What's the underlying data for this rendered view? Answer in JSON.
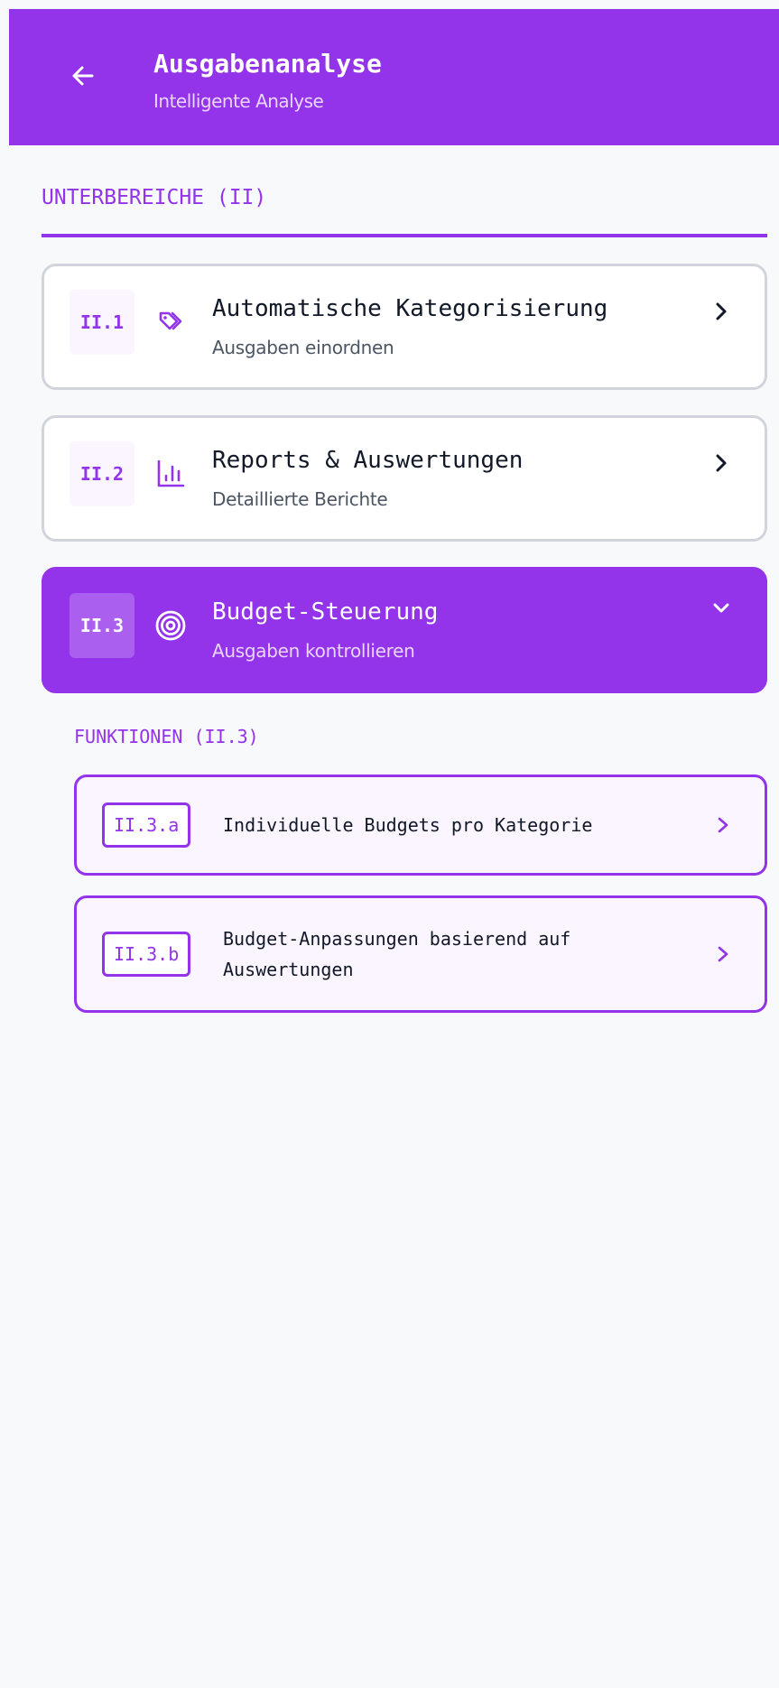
{
  "header": {
    "title": "Ausgabenanalyse",
    "subtitle": "Intelligente Analyse",
    "back_icon": "arrow-left-icon"
  },
  "section": {
    "label": "UNTERBEREICHE (II)"
  },
  "subsections": [
    {
      "code": "II.1",
      "icon": "tags-icon",
      "title": "Automatische Kategorisierung",
      "subtitle": "Ausgaben einordnen",
      "state": "collapsed"
    },
    {
      "code": "II.2",
      "icon": "bar-chart-icon",
      "title": "Reports & Auswertungen",
      "subtitle": "Detaillierte Berichte",
      "state": "collapsed"
    },
    {
      "code": "II.3",
      "icon": "target-icon",
      "title": "Budget-Steuerung",
      "subtitle": "Ausgaben kontrollieren",
      "state": "expanded"
    }
  ],
  "functions": {
    "label": "FUNKTIONEN (II.3)",
    "items": [
      {
        "code": "II.3.a",
        "text": "Individuelle Budgets pro Kategorie"
      },
      {
        "code": "II.3.b",
        "text": "Budget-Anpassungen basierend auf Auswertungen"
      }
    ]
  },
  "colors": {
    "accent": "#9333ea",
    "accent_light": "#faf5ff",
    "background": "#f8f9fb",
    "card_border": "#d1d5db"
  }
}
